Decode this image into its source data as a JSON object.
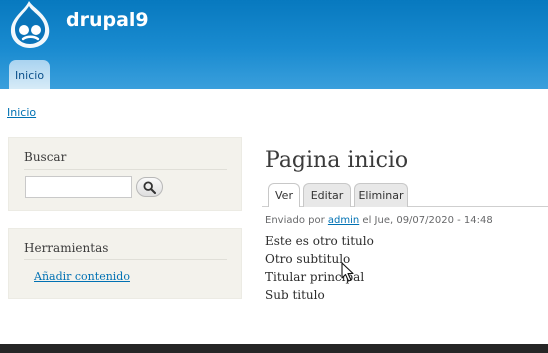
{
  "header": {
    "site_name": "drupal9",
    "logo_icon": "drupal-drop-logo-icon",
    "nav": {
      "home_label": "Inicio"
    }
  },
  "breadcrumb": {
    "home_label": "Inicio"
  },
  "sidebar": {
    "search": {
      "title": "Buscar",
      "input_value": "",
      "button_icon": "search-icon"
    },
    "tools": {
      "title": "Herramientas",
      "links": [
        "Añadir contenido"
      ]
    }
  },
  "main": {
    "title": "Pagina inicio",
    "tabs": [
      {
        "label": "Ver",
        "active": true
      },
      {
        "label": "Editar",
        "active": false
      },
      {
        "label": "Eliminar",
        "active": false
      }
    ],
    "submitted": {
      "prefix": "Enviado por",
      "author": "admin",
      "suffix": "el Jue, 09/07/2020 - 14:48"
    },
    "body_lines": [
      "Este es otro titulo",
      "Otro subtitulo",
      "Titular principal",
      "Sub titulo"
    ]
  },
  "colors": {
    "header_blue": "#0779bf",
    "link_blue": "#0071b3",
    "sidebar_bg": "#f3f2ec"
  }
}
